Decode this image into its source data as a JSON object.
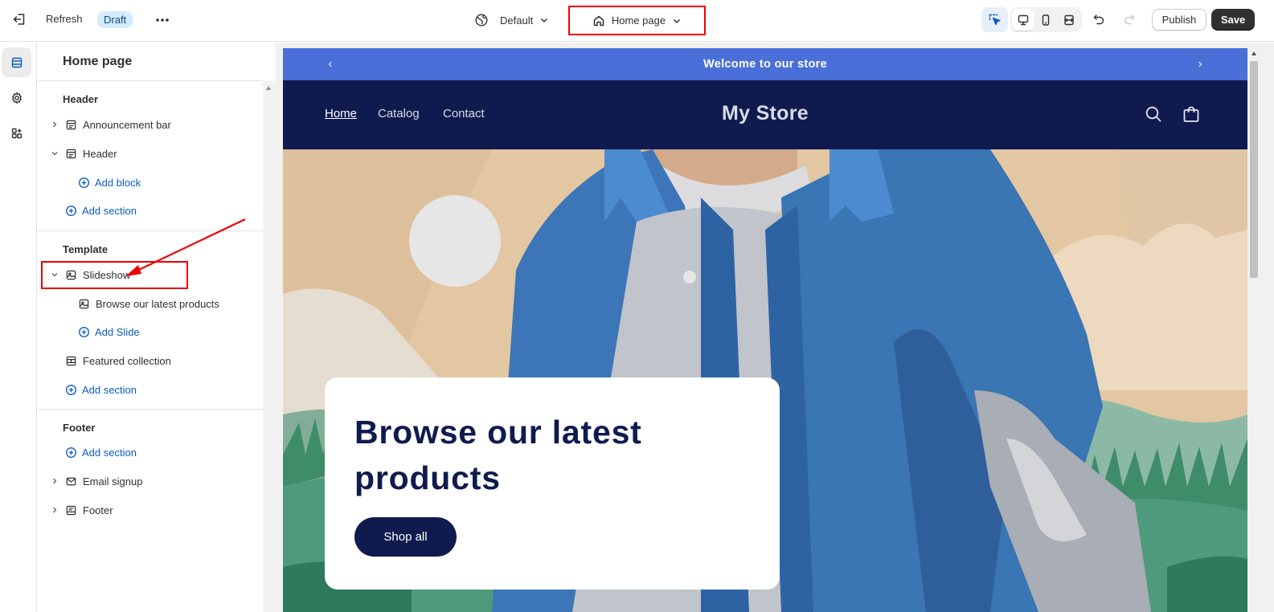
{
  "topbar": {
    "refresh_label": "Refresh",
    "draft_badge": "Draft",
    "theme_label": "Default",
    "page_selector_label": "Home page",
    "publish_label": "Publish",
    "save_label": "Save"
  },
  "sidebar": {
    "title": "Home page",
    "header_group": {
      "heading": "Header",
      "announcement_bar": "Announcement bar",
      "header": "Header",
      "add_block": "Add block",
      "add_section": "Add section"
    },
    "template_group": {
      "heading": "Template",
      "slideshow": "Slideshow",
      "slide_item": "Browse our latest products",
      "add_slide": "Add Slide",
      "featured_collection": "Featured collection",
      "add_section": "Add section"
    },
    "footer_group": {
      "heading": "Footer",
      "add_section": "Add section",
      "email_signup": "Email signup",
      "footer": "Footer"
    }
  },
  "preview": {
    "announcement_text": "Welcome to our store",
    "nav": [
      "Home",
      "Catalog",
      "Contact"
    ],
    "store_name": "My Store",
    "hero_heading": "Browse our latest products",
    "hero_button": "Shop all"
  },
  "colors": {
    "announcement_bg": "#4a6fd8",
    "header_bg": "#0f1b4f",
    "link_blue": "#0b5cc2",
    "highlight_red": "#e00000"
  }
}
